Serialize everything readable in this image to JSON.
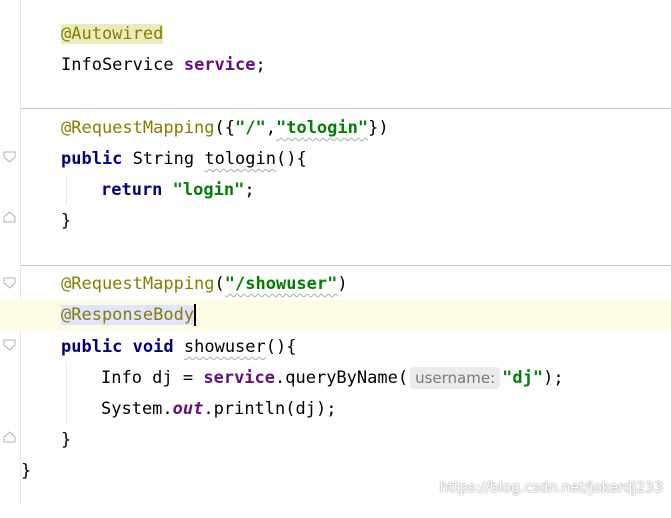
{
  "editor": {
    "lines": {
      "autowired": "@Autowired",
      "field_type": "InfoService",
      "field_name": "service",
      "semicolon": ";",
      "rm1_annotation": "@RequestMapping",
      "rm1_open": "({",
      "rm1_str1": "\"/\"",
      "rm1_comma": ",",
      "rm1_str2": "\"tologin\"",
      "rm1_close": "})",
      "m1_public": "public",
      "m1_type": "String",
      "m1_name": "tologin",
      "m1_parens": "(){",
      "return_kw": "return",
      "return_str": "\"login\"",
      "brace_close": "}",
      "rm2_annotation": "@RequestMapping",
      "rm2_open": "(",
      "rm2_str": "\"/showuser\"",
      "rm2_close": ")",
      "response_body": "@ResponseBody",
      "m2_public": "public",
      "m2_void": "void",
      "m2_name": "showuser",
      "m2_parens": "(){",
      "info_decl": "Info dj = ",
      "info_service": "service",
      "info_call": ".queryByName(",
      "param_hint": "username:",
      "info_arg": "\"dj\"",
      "info_end": ");",
      "sys": "System.",
      "sys_out": "out",
      "sys_call": ".println(dj);",
      "class_close": "}"
    }
  },
  "watermark": "https://blog.csdn.net/jokerdj233",
  "colors": {
    "annotation": "#808000",
    "keyword": "#000080",
    "field": "#660e7a",
    "string": "#008000",
    "current_line": "#fdfbe3"
  },
  "icons": [
    "fold-start-icon",
    "fold-end-icon"
  ]
}
